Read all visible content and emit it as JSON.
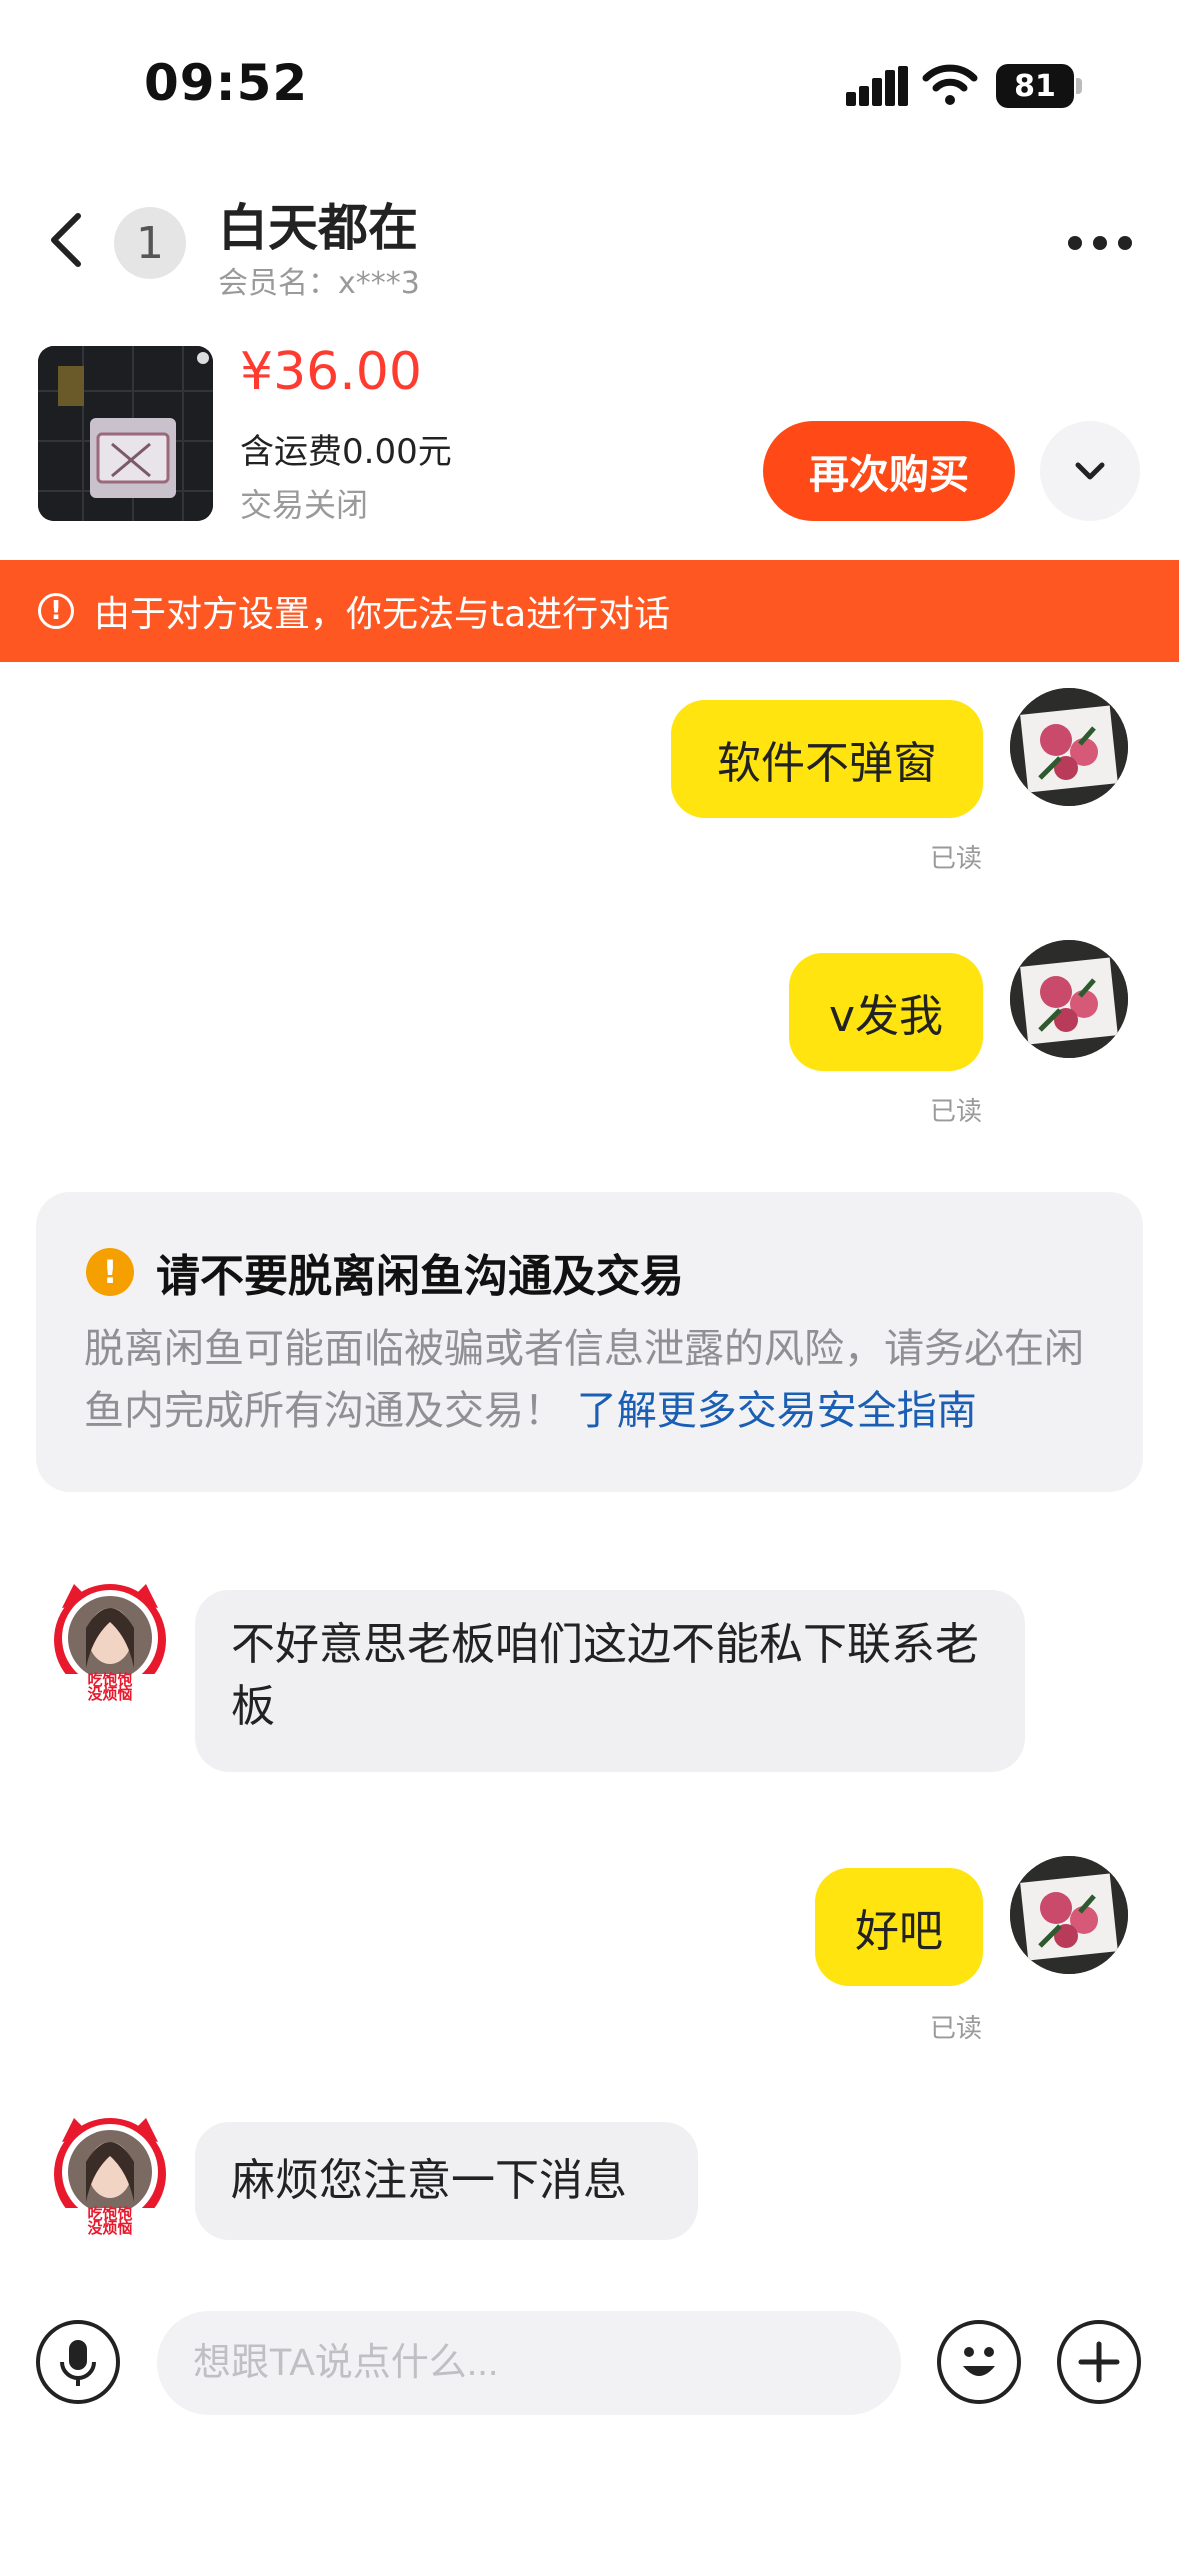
{
  "status_bar": {
    "time": "09:52",
    "battery": "81"
  },
  "header": {
    "unread_count": "1",
    "title": "白天都在",
    "member_name": "会员名：x***3"
  },
  "product": {
    "price": "¥36.00",
    "shipping": "含运费0.00元",
    "status": "交易关闭",
    "buy_again_label": "再次购买"
  },
  "warning_bar": {
    "text": "由于对方设置，你无法与ta进行对话"
  },
  "messages": [
    {
      "from": "me",
      "text": "软件不弹窗",
      "read": "已读"
    },
    {
      "from": "me",
      "text": "v发我",
      "read": "已读"
    },
    {
      "from": "other",
      "text": "不好意思老板咱们这边不能私下联系老板"
    },
    {
      "from": "me",
      "text": "好吧",
      "read": "已读"
    },
    {
      "from": "other",
      "text": "麻烦您注意一下消息"
    }
  ],
  "safety_notice": {
    "title": "请不要脱离闲鱼沟通及交易",
    "body": "脱离闲鱼可能面临被骗或者信息泄露的风险，请务必在闲鱼内完成所有沟通及交易！",
    "link": "了解更多交易安全指南"
  },
  "other_avatar_badge": {
    "line1": "吃饱饱",
    "line2": "没烦恼"
  },
  "composer": {
    "placeholder": "想跟TA说点什么..."
  },
  "colors": {
    "accent": "#ff4a17",
    "bubble_me": "#ffe40f",
    "price": "#ff3b30",
    "link": "#1a5fb4"
  }
}
